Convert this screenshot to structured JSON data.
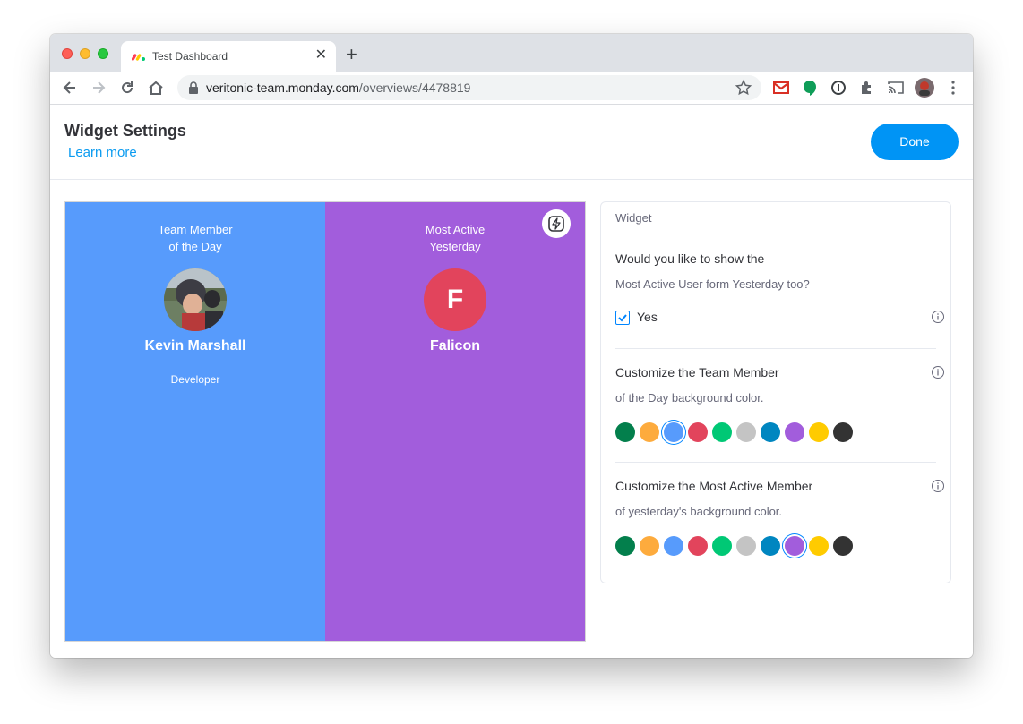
{
  "browser": {
    "tab_title": "Test Dashboard",
    "tab_close": "✕",
    "new_tab": "+",
    "url_domain": "veritonic-team.monday.com",
    "url_path": "/overviews/4478819"
  },
  "header": {
    "title": "Widget Settings",
    "learn_more": "Learn more",
    "done_label": "Done"
  },
  "preview": {
    "left": {
      "title": "Team Member\nof the Day",
      "name": "Kevin Marshall",
      "role": "Developer",
      "background": "#579bfc"
    },
    "right": {
      "title": "Most Active\nYesterday",
      "avatar_letter": "F",
      "name": "Falicon",
      "background": "#a25ddc"
    }
  },
  "panel": {
    "header": "Widget",
    "show_question_line1": "Would you like to show the",
    "show_question_line2": "Most Active User form Yesterday too?",
    "checkbox_label": "Yes",
    "checkbox_checked": true,
    "team_member_title": "Customize the Team Member",
    "team_member_sub": "of the Day background color.",
    "most_active_title": "Customize the Most Active Member",
    "most_active_sub": "of yesterday's background color.",
    "palette": [
      "#037f4c",
      "#fdab3d",
      "#579bfc",
      "#e2445c",
      "#00c875",
      "#c4c4c4",
      "#0086c0",
      "#a25ddc",
      "#ffcb00",
      "#333333"
    ],
    "team_member_selected": "#579bfc",
    "most_active_selected": "#a25ddc"
  }
}
